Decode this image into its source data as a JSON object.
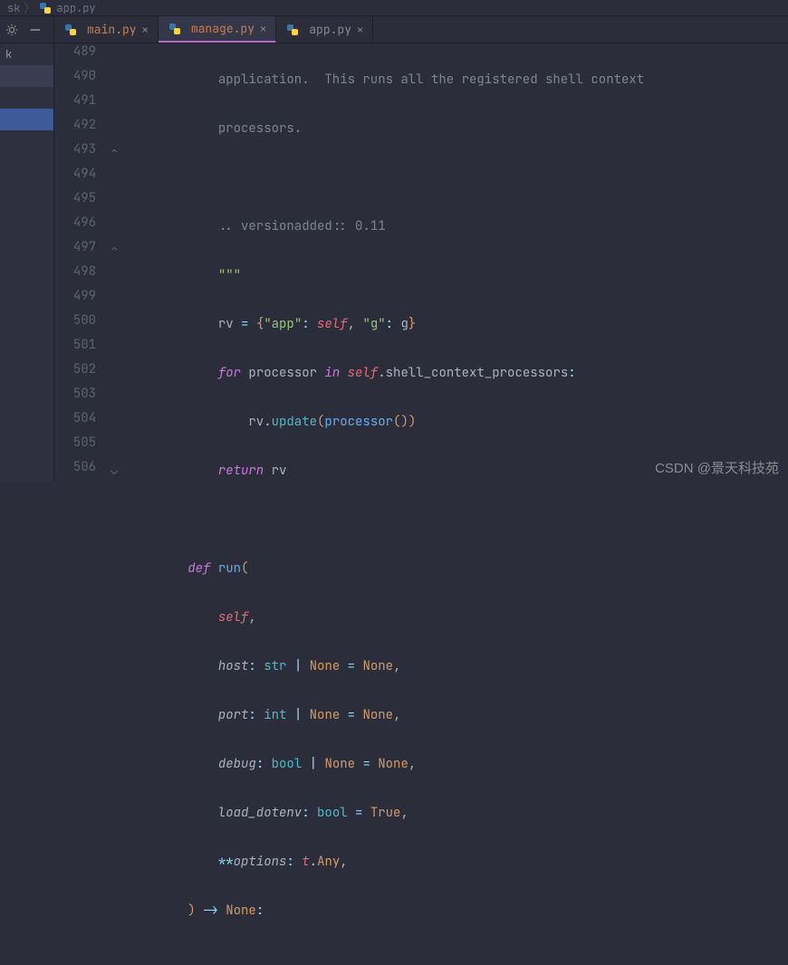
{
  "breadcrumb": {
    "folder": "sk",
    "file": "app.py"
  },
  "toolbar": {
    "gear": "⚙",
    "minimize": "—"
  },
  "tabs": [
    {
      "label": "main.py",
      "active": false
    },
    {
      "label": "manage.py",
      "active": true
    },
    {
      "label": "app.py",
      "active": false,
      "dim": true
    }
  ],
  "sidebar": {
    "items": [
      "k",
      "",
      ""
    ]
  },
  "gutter": {
    "start": 489,
    "end": 506
  },
  "code": {
    "l489": {
      "text": "application.  This runs all the registered shell context"
    },
    "l490": {
      "text": "processors."
    },
    "l492": {
      "prefix": ".. versionadded:: ",
      "ver": "0.11"
    },
    "l493": {
      "text": "\"\"\""
    },
    "l494": {
      "rv": "rv",
      "eq": " = ",
      "lb": "{",
      "k1": "\"app\"",
      "c1": ": ",
      "v1": "self",
      "cm": ", ",
      "k2": "\"g\"",
      "c2": ": ",
      "v2": "g",
      "rb": "}"
    },
    "l495": {
      "for": "for",
      "proc": " processor ",
      "in": "in",
      "sp": " ",
      "self": "self",
      "dot": ".shell_context_processors",
      "col": ":"
    },
    "l496": {
      "rv": "rv.",
      "upd": "update",
      "lp": "(",
      "proc": "processor",
      "lp2": "(",
      "rp2": ")",
      "rp": ")"
    },
    "l497": {
      "ret": "return",
      "rv": " rv"
    },
    "l499": {
      "def": "def",
      "sp": " ",
      "name": "run",
      "lp": "("
    },
    "l500": {
      "self": "self",
      "cm": ","
    },
    "l501": {
      "p": "host",
      "col": ": ",
      "t": "str",
      "bar": " | ",
      "none": "None",
      "eq": " = ",
      "dv": "None",
      "cm": ","
    },
    "l502": {
      "p": "port",
      "col": ": ",
      "t": "int",
      "bar": " | ",
      "none": "None",
      "eq": " = ",
      "dv": "None",
      "cm": ","
    },
    "l503": {
      "p": "debug",
      "col": ": ",
      "t": "bool",
      "bar": " | ",
      "none": "None",
      "eq": " = ",
      "dv": "None",
      "cm": ","
    },
    "l504": {
      "p": "load_dotenv",
      "col": ": ",
      "t": "bool",
      "eq": " = ",
      "dv": "True",
      "cm": ","
    },
    "l505": {
      "stars": "**",
      "p": "options",
      "col": ": ",
      "mod": "t",
      "dot": ".",
      "any": "Any",
      "cm": ","
    },
    "l506": {
      "rp": ")",
      "arrow": " -> ",
      "none": "None",
      "col": ":"
    }
  },
  "watermark": "CSDN @景天科技苑"
}
